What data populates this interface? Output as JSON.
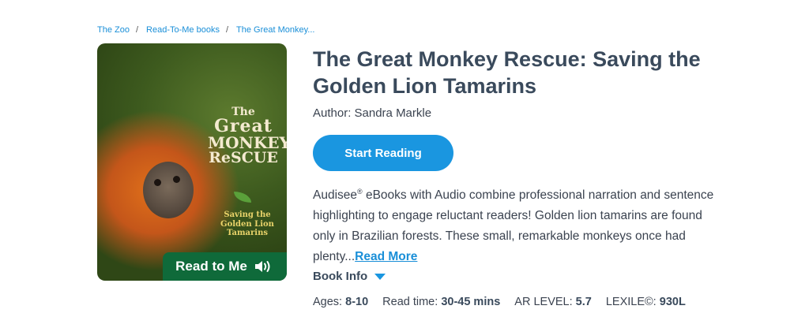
{
  "breadcrumb": {
    "items": [
      "The Zoo",
      "Read-To-Me books",
      "The Great Monkey..."
    ],
    "separator": "/"
  },
  "cover": {
    "title_lines": [
      "The",
      "Great",
      "MONKEY",
      "ReSCUE"
    ],
    "subtitle_lines": [
      "Saving the",
      "Golden Lion",
      "Tamarins"
    ],
    "badge": "Read to Me",
    "badge_icon": "speaker-icon"
  },
  "book": {
    "title": "The Great Monkey Rescue: Saving the Golden Lion Tamarins",
    "author": "Author: Sandra Markle"
  },
  "actions": {
    "start_reading": "Start Reading"
  },
  "description": {
    "brand": "Audisee",
    "reg_mark": "®",
    "text": " eBooks with Audio combine professional narration and sentence highlighting to engage reluctant readers! Golden lion tamarins are found only in Brazilian forests. These small, remarkable monkeys once had plenty...",
    "read_more": "Read More"
  },
  "book_info": {
    "label": "Book Info",
    "icon": "caret-down-icon"
  },
  "meta": {
    "ages_label": "Ages:",
    "ages": "8-10",
    "read_time_label": "Read time:",
    "read_time": "30-45 mins",
    "ar_label": "AR LEVEL:",
    "ar": "5.7",
    "lexile_label": "LEXILE©:",
    "lexile": "930L"
  },
  "colors": {
    "accent": "#1a96e0",
    "link": "#1a8fd8",
    "badge_green": "#0f6a3a",
    "title": "#3a4a5c"
  }
}
